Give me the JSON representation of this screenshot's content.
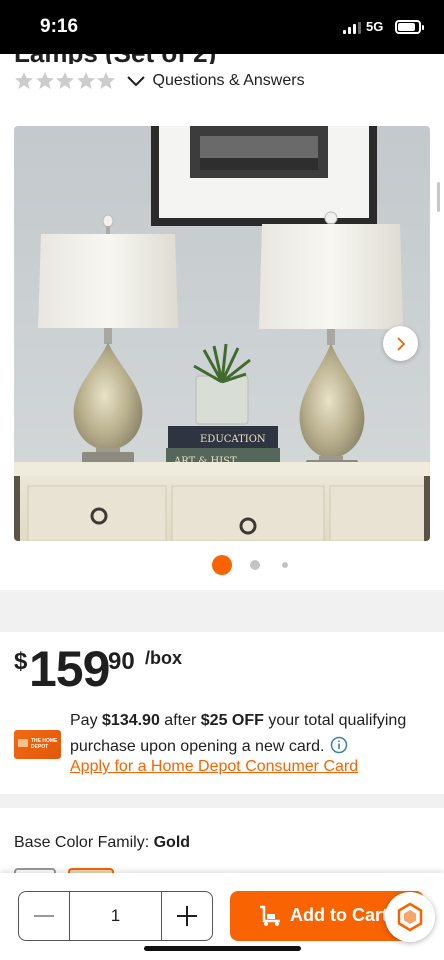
{
  "status_bar": {
    "time": "9:16",
    "network": "5G",
    "battery_level": 0.85
  },
  "product": {
    "title_fragment": "Lamps (Set of 2)"
  },
  "rating": {
    "stars_filled": 0,
    "stars_total": 5,
    "qa_label": "Questions & Answers"
  },
  "gallery": {
    "image_alt": "Two mercury glass table lamps on a cream dresser",
    "books": [
      "EDUCATION",
      "ART & HIST"
    ],
    "current_index": 1,
    "dot_count": 3
  },
  "price": {
    "currency": "$",
    "whole": "159",
    "cents": "90",
    "unit": "/box"
  },
  "offer": {
    "pay_prefix": "Pay ",
    "discounted_price": "$134.90",
    "after_text": " after ",
    "discount": "$25 OFF",
    "suffix": " your total qualifying purchase upon opening a new card.",
    "apply_link": "Apply for a Home Depot Consumer Card",
    "card_logo": "THE HOME DEPOT"
  },
  "color_family": {
    "label": "Base Color Family:",
    "value": "Gold"
  },
  "cart": {
    "quantity": "1",
    "add_label": "Add to Cart"
  },
  "colors": {
    "brand_orange": "#f96302",
    "status_bar_bg": "#000000",
    "star_empty": "#cccccc",
    "dot_inactive": "#c4c4c4"
  },
  "icons": {
    "star": "star-icon",
    "chevron_down": "chevron-down-icon",
    "chevron_right": "chevron-right-icon",
    "info": "info-icon",
    "minus": "minus-icon",
    "plus": "plus-icon",
    "cart": "cart-icon",
    "chat": "chat-icon"
  }
}
